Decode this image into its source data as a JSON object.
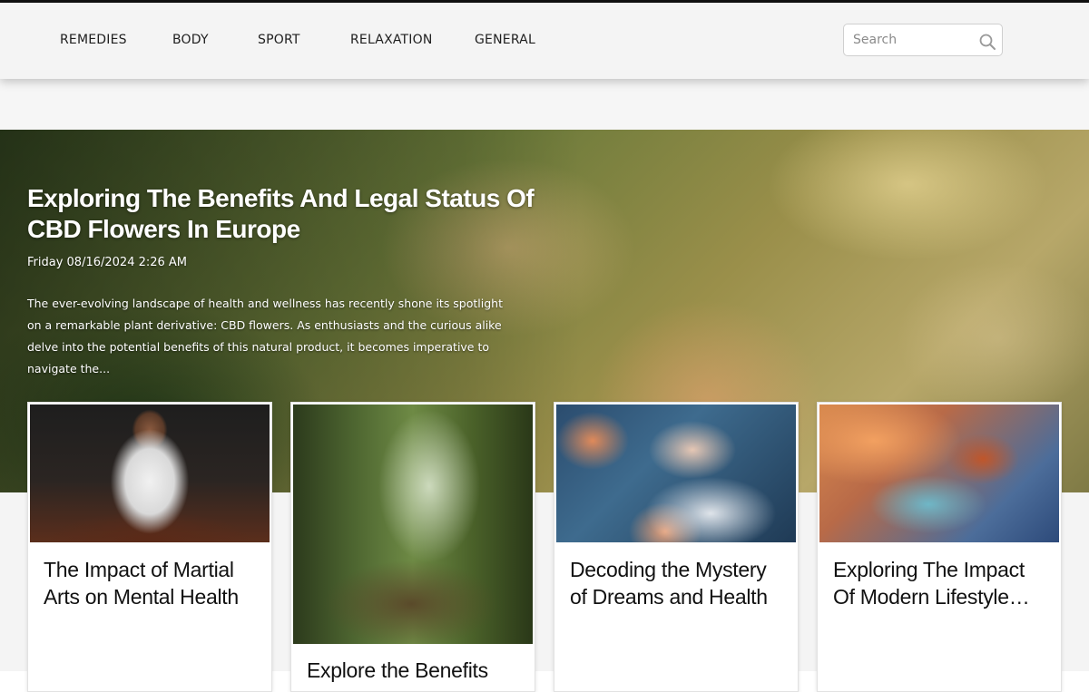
{
  "nav": {
    "items": [
      {
        "label": "REMEDIES"
      },
      {
        "label": "BODY"
      },
      {
        "label": "SPORT"
      },
      {
        "label": "RELAXATION"
      },
      {
        "label": "GENERAL"
      }
    ],
    "search": {
      "placeholder": "Search",
      "icon": "search-icon"
    }
  },
  "hero": {
    "title": "Exploring The Benefits And Legal Status Of CBD Flowers In Europe",
    "date": "Friday 08/16/2024 2:26 AM",
    "excerpt": "The ever-evolving landscape of health and wellness has recently shone its spotlight on a remarkable plant derivative: CBD flowers. As enthusiasts and the curious alike delve into the potential benefits of this natural product, it becomes imperative to navigate the..."
  },
  "cards": [
    {
      "title": "The Impact of Martial Arts on Mental Health"
    },
    {
      "title": "Explore the Benefits"
    },
    {
      "title": "Decoding the Mystery of Dreams and Health"
    },
    {
      "title": "Exploring The Impact Of Modern Lifestyle…"
    }
  ]
}
